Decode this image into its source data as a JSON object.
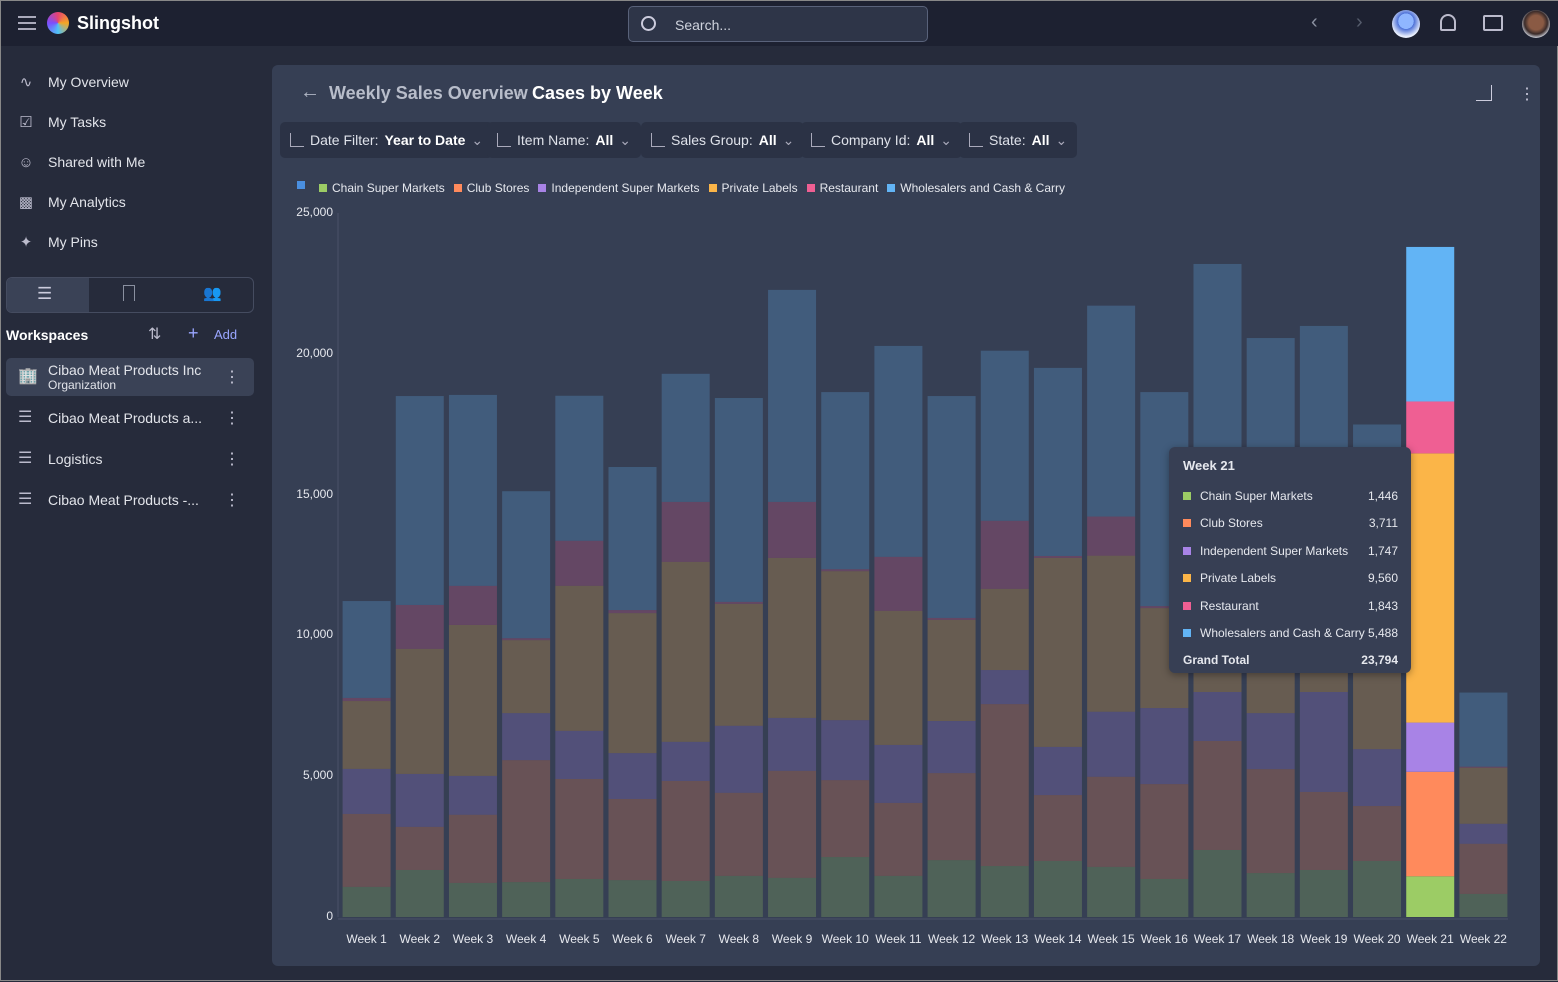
{
  "app": {
    "brand": "Slingshot",
    "search_placeholder": "Search..."
  },
  "sidebar": {
    "items": [
      {
        "label": "My Overview",
        "icon": "activity-icon"
      },
      {
        "label": "My Tasks",
        "icon": "task-icon"
      },
      {
        "label": "Shared with Me",
        "icon": "shared-user-icon"
      },
      {
        "label": "My Analytics",
        "icon": "bar-chart-icon"
      },
      {
        "label": "My Pins",
        "icon": "pin-icon"
      }
    ],
    "workspaces_title": "Workspaces",
    "add_label": "Add",
    "workspaces": [
      {
        "name": "Cibao Meat Products Inc",
        "subtitle": "Organization",
        "selected": true
      },
      {
        "name": "Cibao Meat Products a..."
      },
      {
        "name": "Logistics"
      },
      {
        "name": "Cibao Meat Products -..."
      }
    ]
  },
  "header": {
    "parent": "Weekly Sales Overview",
    "title": "Cases by Week"
  },
  "filters": [
    {
      "label": "Date Filter:",
      "value": "Year to Date"
    },
    {
      "label": "Item Name:",
      "value": "All"
    },
    {
      "label": "Sales Group:",
      "value": "All"
    },
    {
      "label": "Company Id:",
      "value": "All"
    },
    {
      "label": "State:",
      "value": "All"
    }
  ],
  "colors": {
    "legend_extra": "#4a8fe0",
    "series": [
      "#9ccc65",
      "#ff8a5c",
      "#a883e6",
      "#fbb548",
      "#ef5f93",
      "#62b4f5"
    ]
  },
  "tooltip": {
    "title": "Week 21",
    "rows": [
      {
        "label": "Chain Super Markets",
        "value": "1,446"
      },
      {
        "label": "Club Stores",
        "value": "3,711"
      },
      {
        "label": "Independent Super Markets",
        "value": "1,747"
      },
      {
        "label": "Private Labels",
        "value": "9,560"
      },
      {
        "label": "Restaurant",
        "value": "1,843"
      },
      {
        "label": "Wholesalers and Cash & Carry",
        "value": "5,488"
      }
    ],
    "total_label": "Grand Total",
    "total_value": "23,794"
  },
  "chart_data": {
    "type": "bar",
    "stacked": true,
    "ylim": [
      0,
      25000
    ],
    "yticks": [
      "0",
      "5,000",
      "10,000",
      "15,000",
      "20,000",
      "25,000"
    ],
    "ytick_values": [
      0,
      5000,
      10000,
      15000,
      20000,
      25000
    ],
    "highlighted": "Week 21",
    "legend": "top-left",
    "categories": [
      "Week 1",
      "Week 2",
      "Week 3",
      "Week 4",
      "Week 5",
      "Week 6",
      "Week 7",
      "Week 8",
      "Week 9",
      "Week 10",
      "Week 11",
      "Week 12",
      "Week 13",
      "Week 14",
      "Week 15",
      "Week 16",
      "Week 17",
      "Week 18",
      "Week 19",
      "Week 20",
      "Week 21",
      "Week 22"
    ],
    "series": [
      {
        "name": "Chain Super Markets",
        "values": [
          1070,
          1670,
          1210,
          1240,
          1350,
          1310,
          1280,
          1460,
          1390,
          2130,
          1460,
          2020,
          1810,
          1990,
          1780,
          1350,
          2380,
          1560,
          1670,
          1990,
          1446,
          820
        ]
      },
      {
        "name": "Club Stores",
        "values": [
          2590,
          1530,
          2420,
          4330,
          3550,
          2880,
          3550,
          2950,
          3800,
          2730,
          2590,
          3090,
          5750,
          2340,
          3200,
          3370,
          3870,
          3690,
          2770,
          1950,
          3711,
          1780
        ]
      },
      {
        "name": "Independent Super Markets",
        "values": [
          1600,
          1880,
          1380,
          1670,
          1710,
          1630,
          1390,
          2380,
          1880,
          2130,
          2060,
          1850,
          1210,
          1710,
          2310,
          2700,
          1740,
          1990,
          3550,
          2020,
          1747,
          710
        ]
      },
      {
        "name": "Private Labels",
        "values": [
          2410,
          4440,
          5360,
          2590,
          5150,
          4970,
          6390,
          4330,
          5680,
          5290,
          4760,
          3590,
          2880,
          6710,
          5540,
          3550,
          4010,
          4060,
          3010,
          4530,
          9560,
          1990
        ]
      },
      {
        "name": "Restaurant",
        "values": [
          110,
          1560,
          1390,
          70,
          1600,
          110,
          2130,
          70,
          1990,
          70,
          1920,
          70,
          2420,
          70,
          1390,
          70,
          2000,
          1500,
          1500,
          500,
          1843,
          40
        ]
      },
      {
        "name": "Wholesalers and Cash & Carry",
        "values": [
          3440,
          7420,
          6780,
          5220,
          5150,
          5080,
          4550,
          7240,
          7530,
          6290,
          7490,
          7880,
          6040,
          6680,
          7490,
          7600,
          9190,
          7760,
          8490,
          6500,
          5488,
          2630
        ]
      }
    ]
  }
}
